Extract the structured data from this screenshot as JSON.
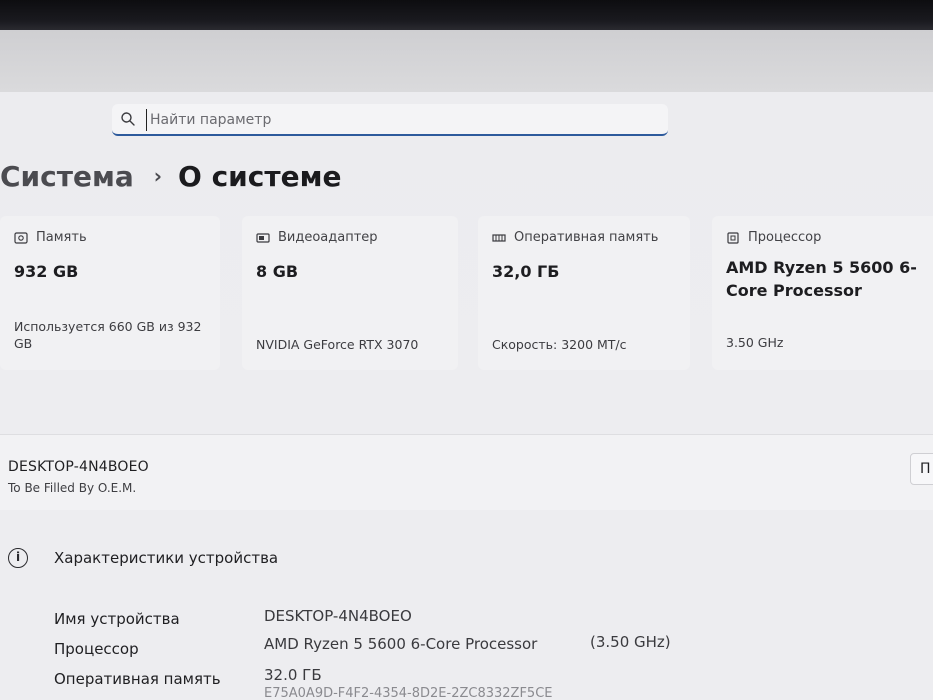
{
  "search": {
    "placeholder": "Найти параметр"
  },
  "breadcrumb": {
    "parent": "Система",
    "separator": "›",
    "current": "О системе"
  },
  "cards": [
    {
      "title": "Память",
      "icon": "storage-icon",
      "value": "932 GB",
      "detail": "Используется 660 GB из 932 GB"
    },
    {
      "title": "Видеоадаптер",
      "icon": "gpu-icon",
      "value": "8 GB",
      "detail": "NVIDIA GeForce RTX 3070"
    },
    {
      "title": "Оперативная память",
      "icon": "ram-icon",
      "value": "32,0 ГБ",
      "detail": "Скорость: 3200 МТ/с"
    },
    {
      "title": "Процессор",
      "icon": "cpu-icon",
      "value": "AMD Ryzen 5 5600 6-Core Processor",
      "detail": "3.50 GHz"
    }
  ],
  "device": {
    "name": "DESKTOP-4N4BOEO",
    "model": "To Be Filled By O.E.M.",
    "rename_label": "П"
  },
  "specs": {
    "title": "Характеристики устройства",
    "rows": [
      {
        "label": "Имя устройства",
        "value": "DESKTOP-4N4BOEO",
        "extra": ""
      },
      {
        "label": "Процессор",
        "value": "AMD Ryzen 5 5600 6-Core Processor",
        "extra": "(3.50 GHz)"
      },
      {
        "label": "Оперативная память",
        "value": "32.0 ГБ",
        "extra": ""
      }
    ],
    "cut_line": "E75A0A9D-F4F2-4354-8D2E-2ZC8332ZF5CE"
  },
  "colors": {
    "accent": "#2d5a9c",
    "card_bg": "#f1f1f3",
    "page_bg": "#ececef"
  }
}
